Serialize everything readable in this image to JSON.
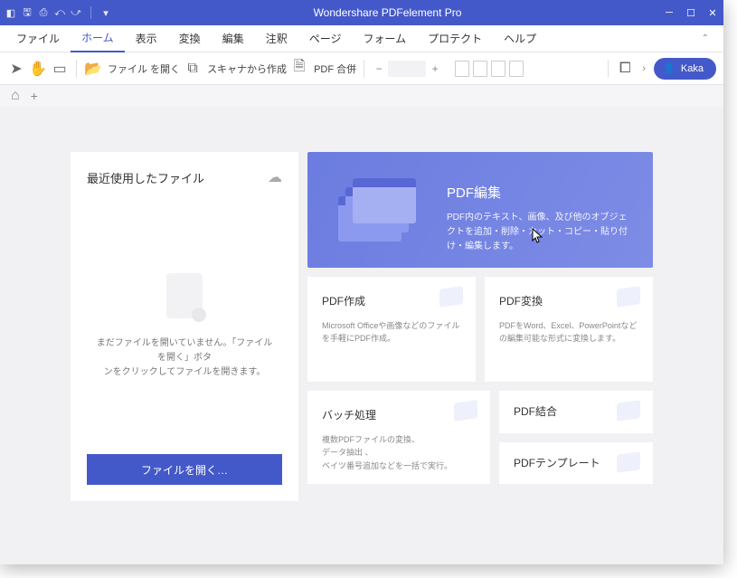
{
  "titlebar": {
    "title": "Wondershare PDFelement Pro"
  },
  "menu": {
    "items": [
      "ファイル",
      "ホーム",
      "表示",
      "変換",
      "編集",
      "注釈",
      "ページ",
      "フォーム",
      "プロテクト",
      "ヘルプ"
    ],
    "active_index": 1
  },
  "toolbar": {
    "open_label": "ファイル を開く",
    "scan_label": "スキャナから作成",
    "merge_label": "PDF 合併",
    "user": "Kaka"
  },
  "recent": {
    "title": "最近使用したファイル",
    "empty_line1": "まだファイルを開いていません。「ファイルを開く」ボタ",
    "empty_line2": "ンをクリックしてファイルを開きます。",
    "open_button": "ファイルを開く…"
  },
  "hero": {
    "title": "PDF編集",
    "desc": "PDF内のテキスト、画像、及び他のオブジェクトを追加・削除・カット・コピー・貼り付け・編集します。"
  },
  "cards": {
    "create": {
      "title": "PDF作成",
      "desc": "Microsoft Officeや画像などのファイルを手軽にPDF作成。"
    },
    "convert": {
      "title": "PDF変換",
      "desc": "PDFをWord、Excel、PowerPointなどの編集可能な形式に変換します。"
    },
    "batch": {
      "title": "バッチ処理",
      "desc": "複数PDFファイルの変換、\nデータ抽出 、\nベイツ番号追加などを一括で実行。"
    },
    "combine": {
      "title": "PDF結合"
    },
    "template": {
      "title": "PDFテンプレート"
    }
  }
}
